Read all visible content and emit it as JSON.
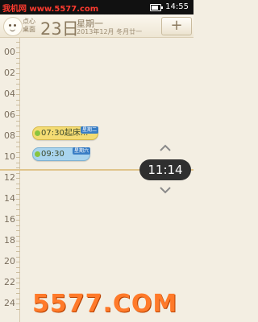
{
  "statusbar": {
    "site": "我机网 www.5577.com",
    "time": "14:55",
    "battery_level": 0.8
  },
  "header": {
    "app_name": "点心 桌面",
    "day": "23日",
    "weekday": "星期一",
    "lunar": "2013年12月 冬月廿一",
    "add_label": "+"
  },
  "timeline": {
    "hours": [
      "00",
      "02",
      "04",
      "06",
      "08",
      "10",
      "12",
      "14",
      "16",
      "18",
      "20",
      "22",
      "24"
    ]
  },
  "events": [
    {
      "time": "07:30",
      "title": "起床...",
      "tag": "星期二",
      "color": "#f4dc73"
    },
    {
      "time": "09:30",
      "title": "",
      "tag": "星期六",
      "color": "#a9d4ee"
    }
  ],
  "now": {
    "time": "11:14"
  },
  "watermark": "5577.COM"
}
